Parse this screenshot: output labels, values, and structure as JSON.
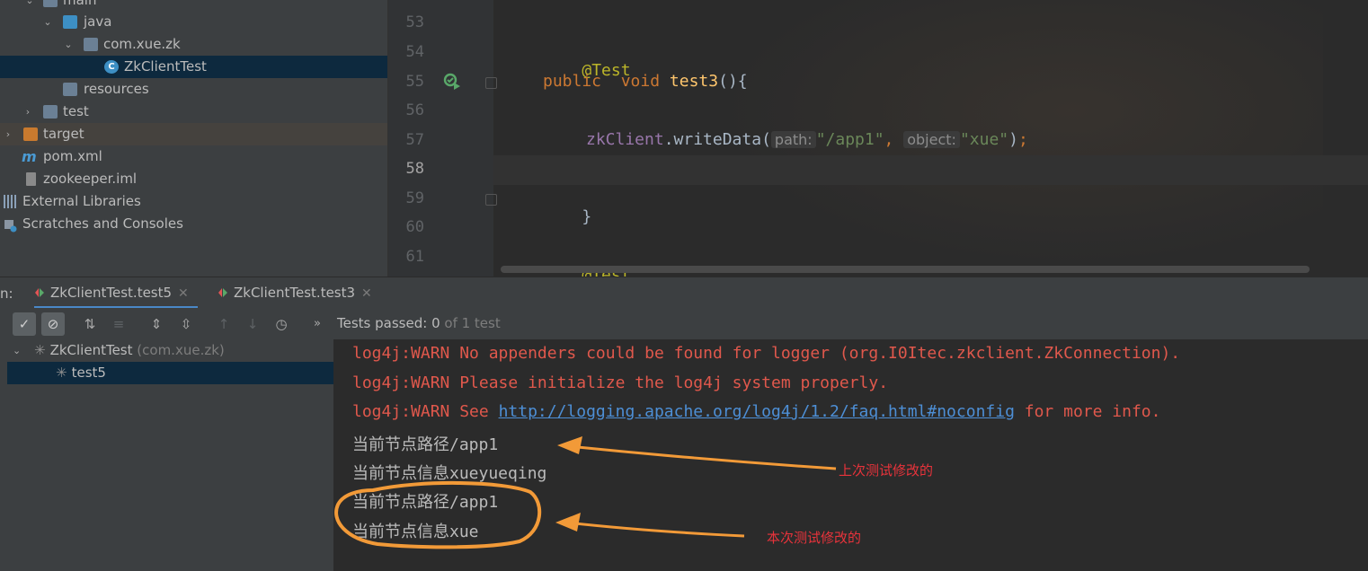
{
  "project_tree": {
    "items": [
      {
        "label": "main"
      },
      {
        "label": "java"
      },
      {
        "label": "com.xue.zk"
      },
      {
        "label": "ZkClientTest"
      },
      {
        "label": "resources"
      },
      {
        "label": "test"
      },
      {
        "label": "target"
      },
      {
        "label": "pom.xml"
      },
      {
        "label": "zookeeper.iml"
      },
      {
        "label": "External Libraries"
      },
      {
        "label": "Scratches and Consoles"
      }
    ]
  },
  "editor": {
    "line_numbers": [
      "53",
      "54",
      "55",
      "56",
      "57",
      "58",
      "59",
      "60",
      "61"
    ],
    "code": {
      "l54_annotation": "@Test",
      "l55_public": "public",
      "l55_void": "void",
      "l55_method": "test3",
      "l55_paren": "(){",
      "l57_field": "zkClient",
      "l57_dot": ".writeData(",
      "l57_hint_path": "path:",
      "l57_str_path": "\"/app1\"",
      "l57_comma": ",",
      "l57_hint_object": "object:",
      "l57_str_object": "\"xue\"",
      "l57_end_paren": ")",
      "l57_semicolon": ";",
      "l59_brace": "}",
      "l61_annotation": "@Test"
    }
  },
  "run_panel": {
    "label": "n:",
    "tabs": [
      {
        "label": "ZkClientTest.test5",
        "active": true
      },
      {
        "label": "ZkClientTest.test3",
        "active": false
      }
    ],
    "status_prefix": "Tests passed:",
    "status_count": "0",
    "status_suffix": "of 1 test"
  },
  "test_tree": {
    "root_label": "ZkClientTest",
    "root_package": "(com.xue.zk)",
    "child_label": "test5"
  },
  "console": {
    "warn1": "log4j:WARN No appenders could be found for logger (org.I0Itec.zkclient.ZkConnection).",
    "warn2": "log4j:WARN Please initialize the log4j system properly.",
    "warn3_prefix": "log4j:WARN See ",
    "warn3_link": "http://logging.apache.org/log4j/1.2/faq.html#noconfig",
    "warn3_suffix": " for more info.",
    "out1": "当前节点路径/app1",
    "out2": "当前节点信息xueyueqing",
    "out3": "当前节点路径/app1",
    "out4": "当前节点信息xue"
  },
  "annotations": {
    "note_previous": "上次测试修改的",
    "note_current": "本次测试修改的"
  },
  "colors": {
    "annotation_orange": "#f29a38",
    "annotation_red": "#e8333b",
    "warn_red": "#e0584c",
    "link_blue": "#4d8fd6",
    "keyword": "#cc7832",
    "string": "#6a8759"
  }
}
